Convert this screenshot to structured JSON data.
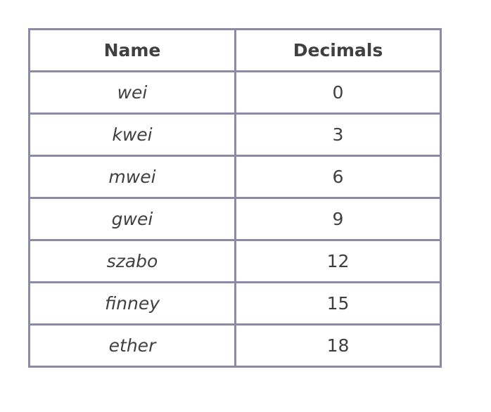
{
  "table": {
    "headers": [
      "Name",
      "Decimals"
    ],
    "rows": [
      {
        "name": "wei",
        "decimals": "0"
      },
      {
        "name": "kwei",
        "decimals": "3"
      },
      {
        "name": "mwei",
        "decimals": "6"
      },
      {
        "name": "gwei",
        "decimals": "9"
      },
      {
        "name": "szabo",
        "decimals": "12"
      },
      {
        "name": "finney",
        "decimals": "15"
      },
      {
        "name": "ether",
        "decimals": "18"
      }
    ]
  }
}
